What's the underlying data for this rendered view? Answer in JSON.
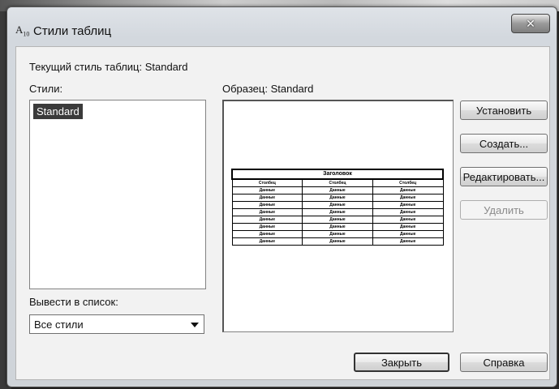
{
  "window": {
    "icon_text": "A",
    "icon_sub": "10",
    "title": "Стили таблиц",
    "close_glyph": "✕"
  },
  "current_style": {
    "label": "Текущий стиль таблиц: Standard"
  },
  "styles": {
    "label": "Стили:",
    "items": [
      "Standard"
    ],
    "selected": "Standard"
  },
  "preview": {
    "label": "Образец: Standard",
    "table": {
      "caption": "Заголовок",
      "headers": [
        "Столбец",
        "Столбец",
        "Столбец"
      ],
      "rows": [
        [
          "Данные",
          "Данные",
          "Данные"
        ],
        [
          "Данные",
          "Данные",
          "Данные"
        ],
        [
          "Данные",
          "Данные",
          "Данные"
        ],
        [
          "Данные",
          "Данные",
          "Данные"
        ],
        [
          "Данные",
          "Данные",
          "Данные"
        ],
        [
          "Данные",
          "Данные",
          "Данные"
        ],
        [
          "Данные",
          "Данные",
          "Данные"
        ],
        [
          "Данные",
          "Данные",
          "Данные"
        ]
      ]
    }
  },
  "buttons": {
    "set_current": "Установить",
    "create": "Создать...",
    "modify": "Редактировать...",
    "delete": "Удалить",
    "close": "Закрыть",
    "help": "Справка"
  },
  "list_filter": {
    "label": "Вывести в список:",
    "value": "Все стили"
  }
}
